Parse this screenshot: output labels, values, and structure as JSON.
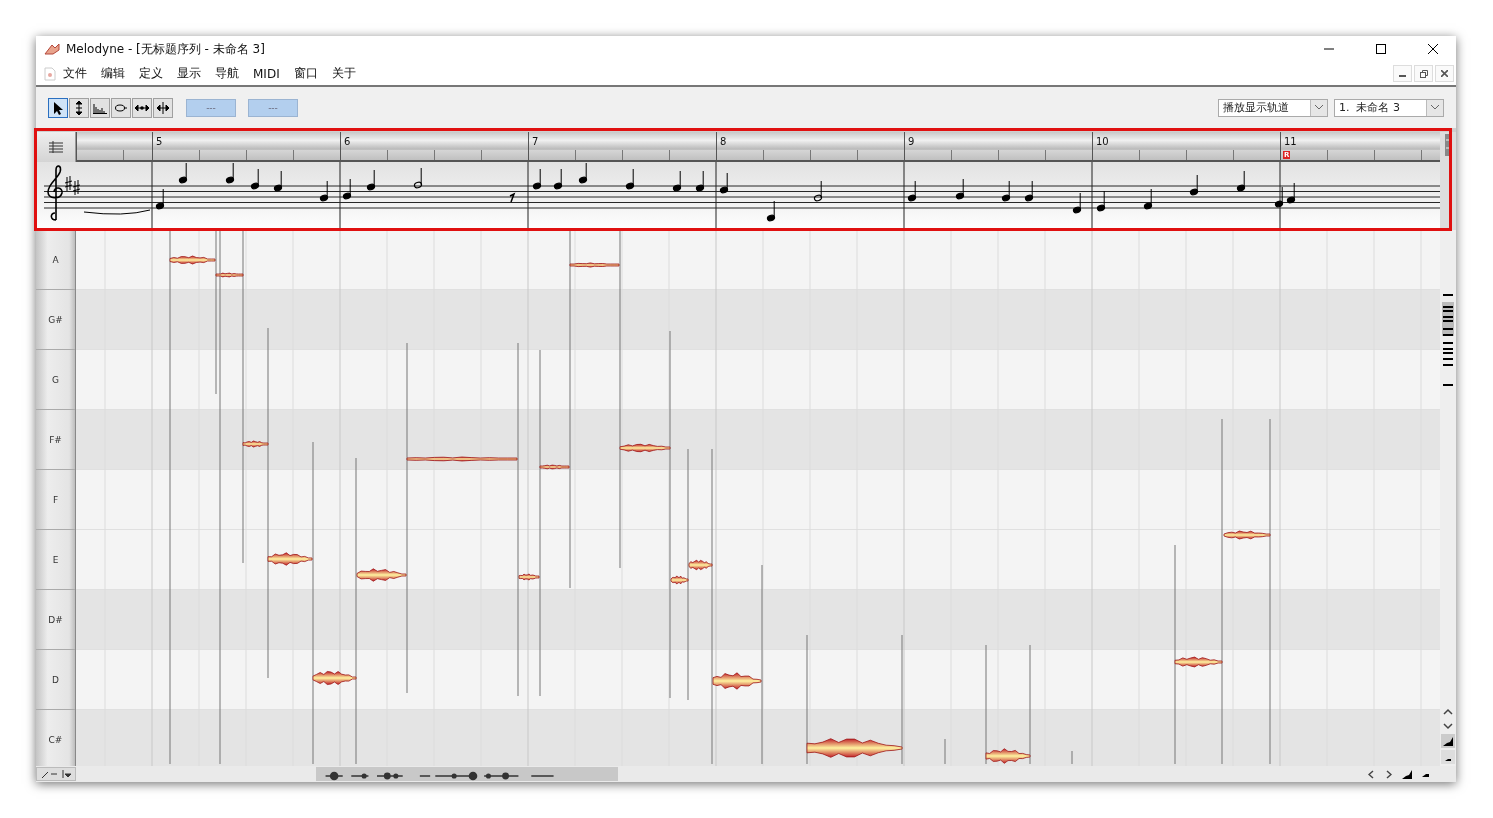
{
  "window": {
    "title": "Melodyne - [无标题序列 - 未命名 3]"
  },
  "menu": [
    "文件",
    "编辑",
    "定义",
    "显示",
    "导航",
    "MIDI",
    "窗口",
    "关于"
  ],
  "toolbar": {
    "tools": [
      {
        "kind": "pointer",
        "selected": true
      },
      {
        "kind": "pitch",
        "selected": false
      },
      {
        "kind": "amplitude",
        "selected": false
      },
      {
        "kind": "formant",
        "selected": false
      },
      {
        "kind": "time",
        "selected": false
      },
      {
        "kind": "split",
        "selected": false
      }
    ],
    "buttons": [
      "---",
      "---"
    ],
    "dropdowns": [
      "播放显示轨道",
      "1.  未命名 3"
    ]
  },
  "ruler": {
    "bars": [
      {
        "number": "5"
      },
      {
        "number": "6"
      },
      {
        "number": "7"
      },
      {
        "number": "8"
      },
      {
        "number": "9"
      },
      {
        "number": "10"
      },
      {
        "number": "11",
        "marker": "R"
      }
    ]
  },
  "lanes": [
    {
      "label": "A",
      "shaded": false
    },
    {
      "label": "G#",
      "shaded": true
    },
    {
      "label": "G",
      "shaded": false
    },
    {
      "label": "F#",
      "shaded": true
    },
    {
      "label": "F",
      "shaded": false
    },
    {
      "label": "E",
      "shaded": false
    },
    {
      "label": "D#",
      "shaded": true
    },
    {
      "label": "D",
      "shaded": false
    },
    {
      "label": "C#",
      "shaded": true
    }
  ]
}
